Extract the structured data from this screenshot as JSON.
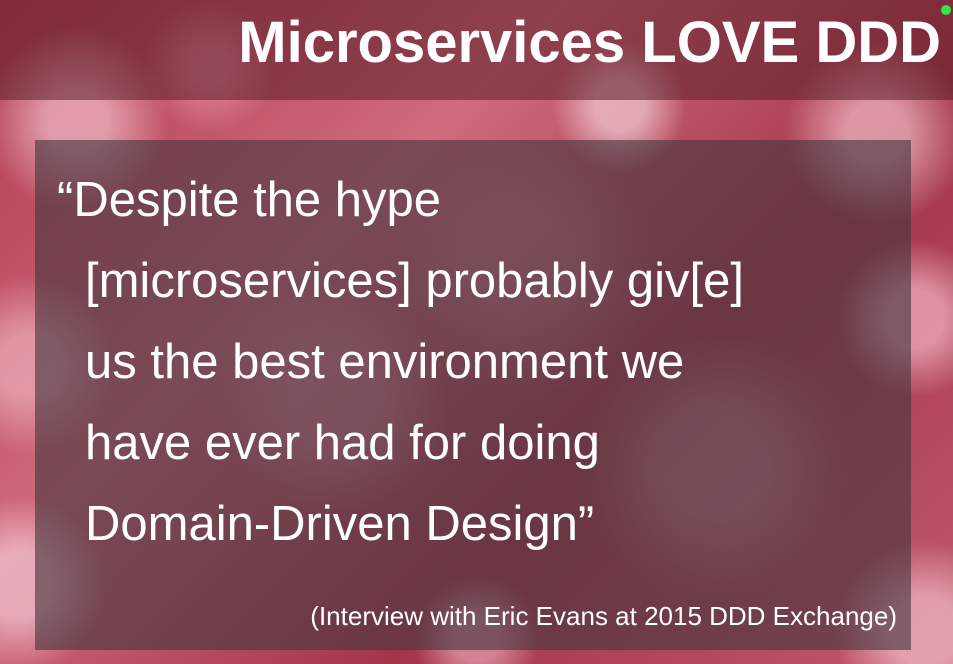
{
  "slide": {
    "title": "Microservices LOVE DDD",
    "quote_lines": [
      "“Despite the hype",
      "[microservices] probably giv[e]",
      "us the best environment we",
      "have ever had for doing",
      "Domain-Driven Design”"
    ],
    "attribution": "(Interview with Eric Evans at 2015 DDD Exchange)"
  },
  "colors": {
    "status_dot": "#2ee84a",
    "text": "#ffffff"
  }
}
